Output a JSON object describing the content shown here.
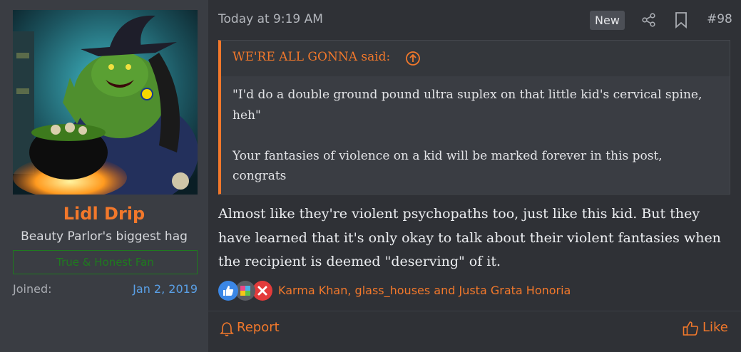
{
  "user": {
    "name": "Lidl Drip",
    "title": "Beauty Parlor's biggest hag",
    "banner": "True & Honest Fan",
    "joined_label": "Joined:",
    "joined_value": "Jan 2, 2019",
    "avatar_icon": "witch-cauldron-avatar"
  },
  "post": {
    "time": "Today at 9:19 AM",
    "new_badge": "New",
    "number": "#98",
    "quote": {
      "author": "WE'RE ALL GONNA said:",
      "line1": "\"I'd do a double ground pound ultra suplex on that little kid's cervical spine, heh\"",
      "line2": "Your fantasies of violence on a kid will be marked forever in this post, congrats"
    },
    "message": "Almost like they're violent psychopaths too, just like this kid. But they have learned that it's only okay to talk about their violent fantasies when the recipient is deemed \"deserving\" of it.",
    "reactions": {
      "icons": [
        "thumbs-up-icon",
        "puzzle-icon",
        "x-icon"
      ],
      "users": "Karma Khan, glass_houses and Justa Grata Honoria"
    },
    "actions": {
      "report": "Report",
      "like": "Like"
    }
  },
  "colors": {
    "accent": "#f2782b",
    "link_blue": "#5aa0e6",
    "banner_green": "#1f7a1f"
  }
}
